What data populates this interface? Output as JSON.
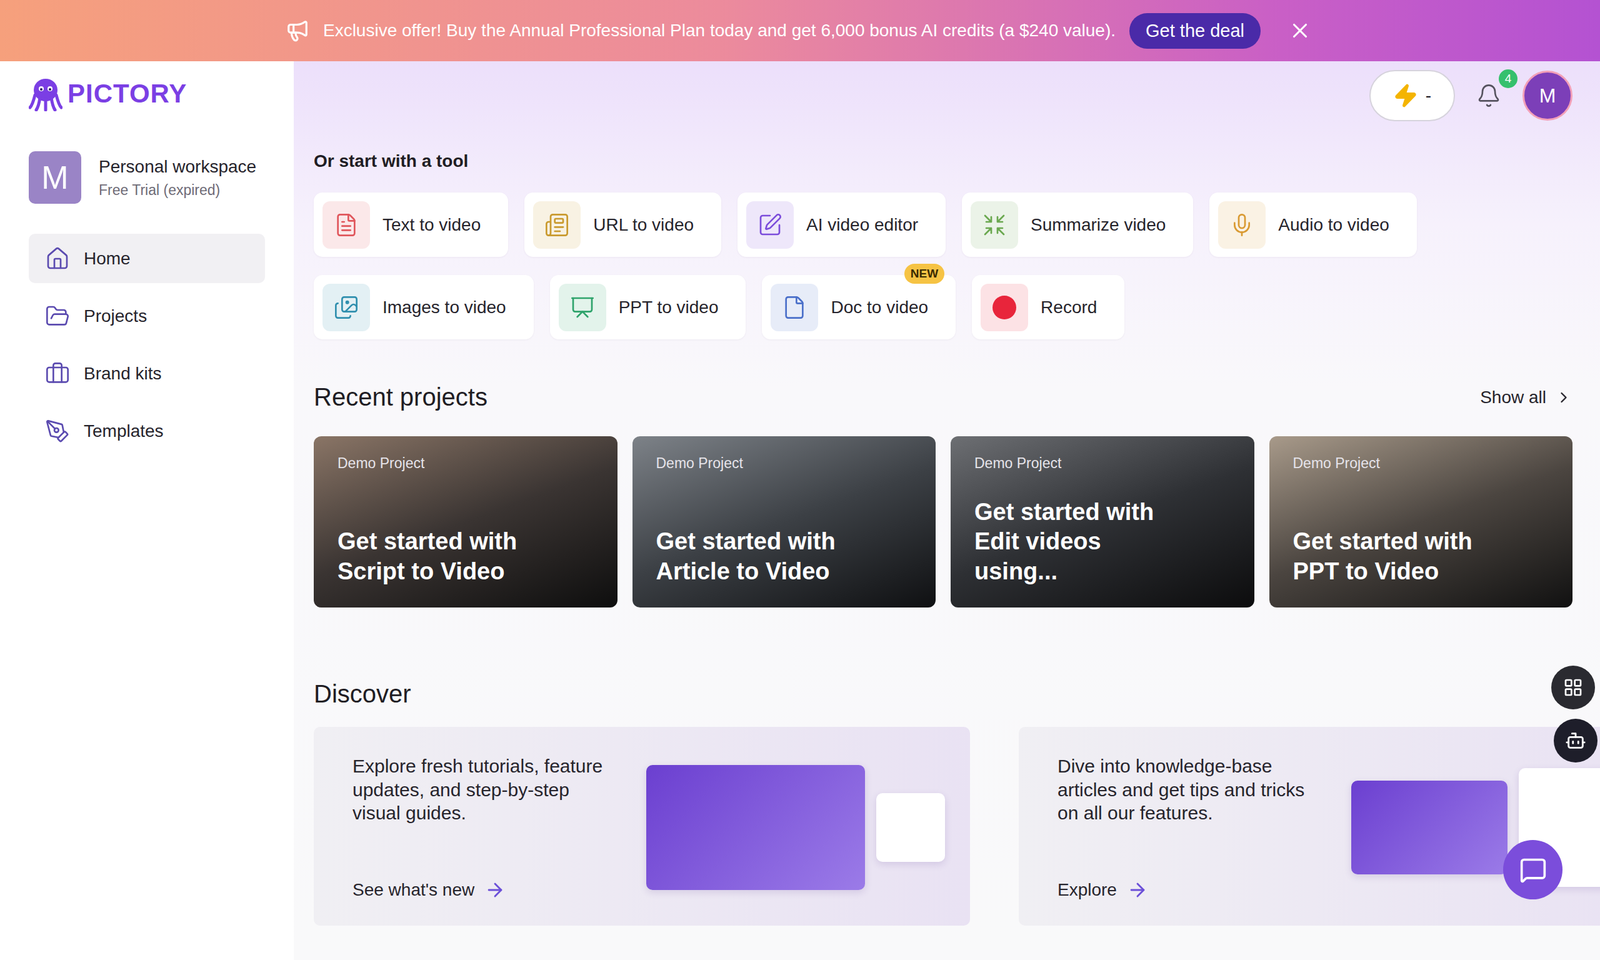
{
  "banner": {
    "text": "Exclusive offer! Buy the Annual Professional Plan today and get 6,000 bonus AI credits (a $240 value).",
    "button": "Get the deal"
  },
  "logo": {
    "text": "PICTORY"
  },
  "workspace": {
    "initial": "M",
    "name": "Personal workspace",
    "plan": "Free Trial (expired)"
  },
  "sidebar": {
    "items": [
      {
        "label": "Home",
        "selected": true
      },
      {
        "label": "Projects",
        "selected": false
      },
      {
        "label": "Brand kits",
        "selected": false
      },
      {
        "label": "Templates",
        "selected": false
      }
    ]
  },
  "header": {
    "credits": "-",
    "notifications": "4",
    "avatar": "M"
  },
  "tools_title": "Or start with a tool",
  "tool_rows": [
    [
      {
        "label": "Text to video",
        "color": "#e0565b",
        "badge": ""
      },
      {
        "label": "URL to video",
        "color": "#c99a2e",
        "badge": ""
      },
      {
        "label": "AI video editor",
        "color": "#7c4ddb",
        "badge": ""
      },
      {
        "label": "Summarize video",
        "color": "#6aa84f",
        "badge": ""
      },
      {
        "label": "Audio to video",
        "color": "#d99a32",
        "badge": ""
      }
    ],
    [
      {
        "label": "Images to video",
        "color": "#2f8fae",
        "badge": ""
      },
      {
        "label": "PPT to video",
        "color": "#2ea36b",
        "badge": ""
      },
      {
        "label": "Doc to video",
        "color": "#4a6fc9",
        "badge": "NEW"
      },
      {
        "label": "Record",
        "color": "#e8253b",
        "badge": ""
      }
    ]
  ],
  "recent": {
    "title": "Recent projects",
    "show_all": "Show all",
    "projects": [
      {
        "tag": "Demo Project",
        "title": "Get started with Script to Video"
      },
      {
        "tag": "Demo Project",
        "title": "Get started with Article to Video"
      },
      {
        "tag": "Demo Project",
        "title": "Get started with Edit videos using..."
      },
      {
        "tag": "Demo Project",
        "title": "Get started with PPT to Video"
      }
    ]
  },
  "discover": {
    "title": "Discover",
    "cards": [
      {
        "text": "Explore fresh tutorials, feature updates, and step-by-step visual guides.",
        "link": "See what's new"
      },
      {
        "text": "Dive into knowledge-base articles and get tips and tricks on all our features.",
        "link": "Explore"
      }
    ]
  }
}
